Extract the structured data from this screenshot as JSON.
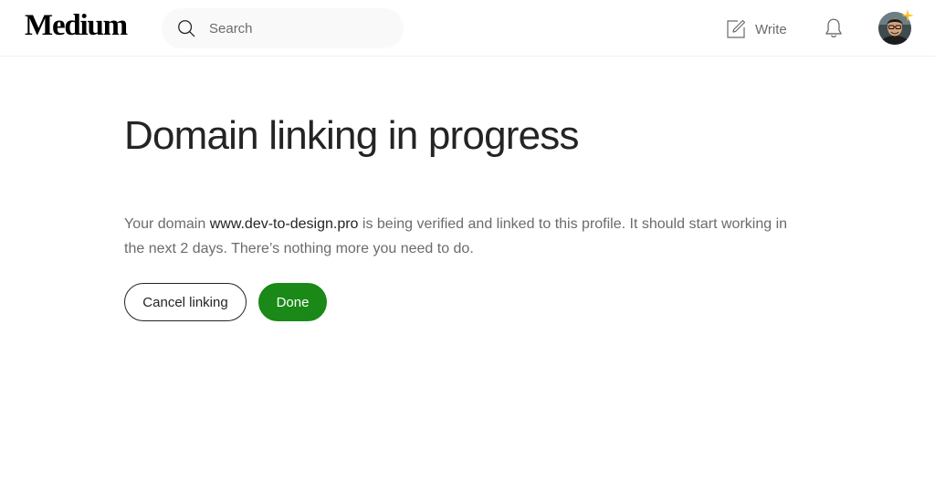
{
  "header": {
    "logo": "Medium",
    "search": {
      "placeholder": "Search",
      "value": "",
      "icon": "search-icon"
    },
    "write_label": "Write",
    "write_icon": "write-icon",
    "notifications_icon": "bell-icon",
    "avatar_icon": "avatar",
    "sparkle_color": "#ffc017"
  },
  "main": {
    "title": "Domain linking in progress",
    "description_before": "Your domain ",
    "domain": "www.dev-to-design.pro",
    "description_after": " is being verified and linked to this profile. It should start working in the next 2 days. There’s nothing more you need to do.",
    "cancel_label": "Cancel linking",
    "done_label": "Done"
  },
  "colors": {
    "accent_green": "#1a8917",
    "text_primary": "#242424",
    "text_secondary": "#6b6b6b",
    "search_bg": "#f9f9f9"
  }
}
